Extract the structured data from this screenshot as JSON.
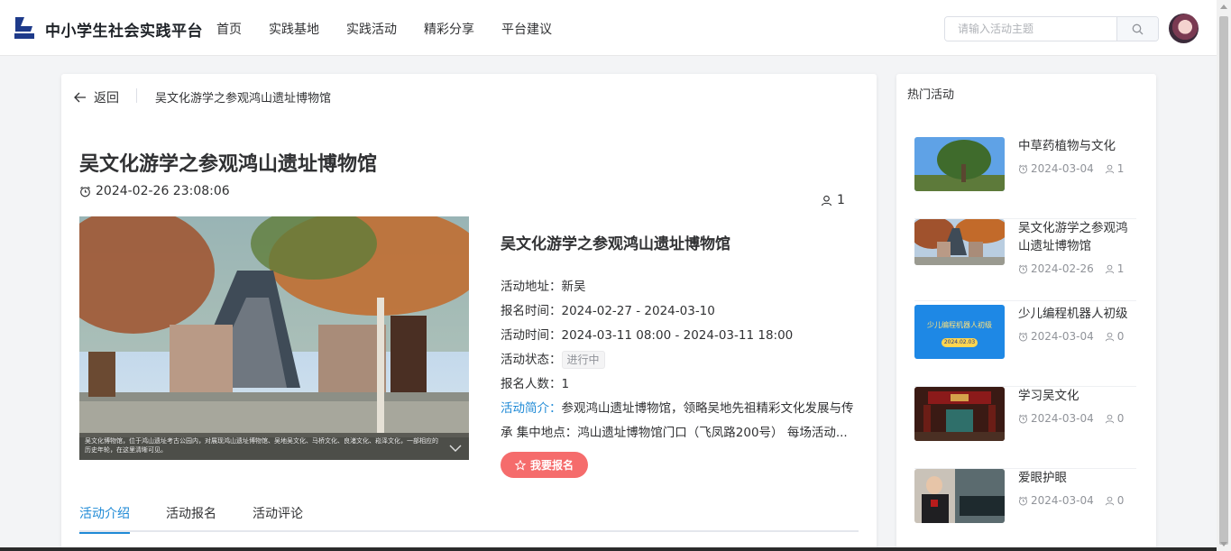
{
  "header": {
    "brand": "中小学生社会实践平台",
    "nav": [
      "首页",
      "实践基地",
      "实践活动",
      "精彩分享",
      "平台建议"
    ],
    "search_placeholder": "请输入活动主题"
  },
  "breadcrumb": {
    "back_label": "返回",
    "current": "吴文化游学之参观鸿山遗址博物馆"
  },
  "activity": {
    "title": "吴文化游学之参观鸿山遗址博物馆",
    "published": "2024-02-26 23:08:06",
    "likes": "1",
    "photo_caption": "吴文化博物馆，位于鸿山遗址考古公园内，对展现鸿山遗址博物馆、吴地吴文化、马桥文化、良渚文化、崧泽文化，一部相应的历史年轮，在这里清晰可见。",
    "subtitle": "吴文化游学之参观鸿山遗址博物馆",
    "address_label": "活动地址：",
    "address": "新吴",
    "signup_time_label": "报名时间：",
    "signup_time": "2024-02-27 - 2024-03-10",
    "activity_time_label": "活动时间：",
    "activity_time": "2024-03-11 08:00 - 2024-03-11 18:00",
    "status_label": "活动状态：",
    "status": "进行中",
    "count_label": "报名人数：",
    "count": "1",
    "intro_label": "活动简介：",
    "intro": "参观鸿山遗址博物馆，领略吴地先祖精彩文化发展与传承 集中地点：鸿山遗址博物馆门口（飞凤路200号） 每场活动...",
    "signup_button": "我要报名"
  },
  "tabs": [
    "活动介绍",
    "活动报名",
    "活动评论"
  ],
  "sidebar": {
    "title": "热门活动",
    "items": [
      {
        "title": "中草药植物与文化",
        "date": "2024-03-04",
        "count": "1"
      },
      {
        "title": "吴文化游学之参观鸿山遗址博物馆",
        "date": "2024-02-26",
        "count": "1"
      },
      {
        "title": "少儿编程机器人初级",
        "date": "2024-03-04",
        "count": "0",
        "thumb_text": "少儿编程机器人初级",
        "thumb_date": "2024.02.03"
      },
      {
        "title": "学习吴文化",
        "date": "2024-03-04",
        "count": "0"
      },
      {
        "title": "爱眼护眼",
        "date": "2024-03-04",
        "count": "0"
      }
    ]
  },
  "colors": {
    "accent": "#1f8ad6",
    "signup": "#f56c6c",
    "brand_logo": "#1e3a8a"
  }
}
